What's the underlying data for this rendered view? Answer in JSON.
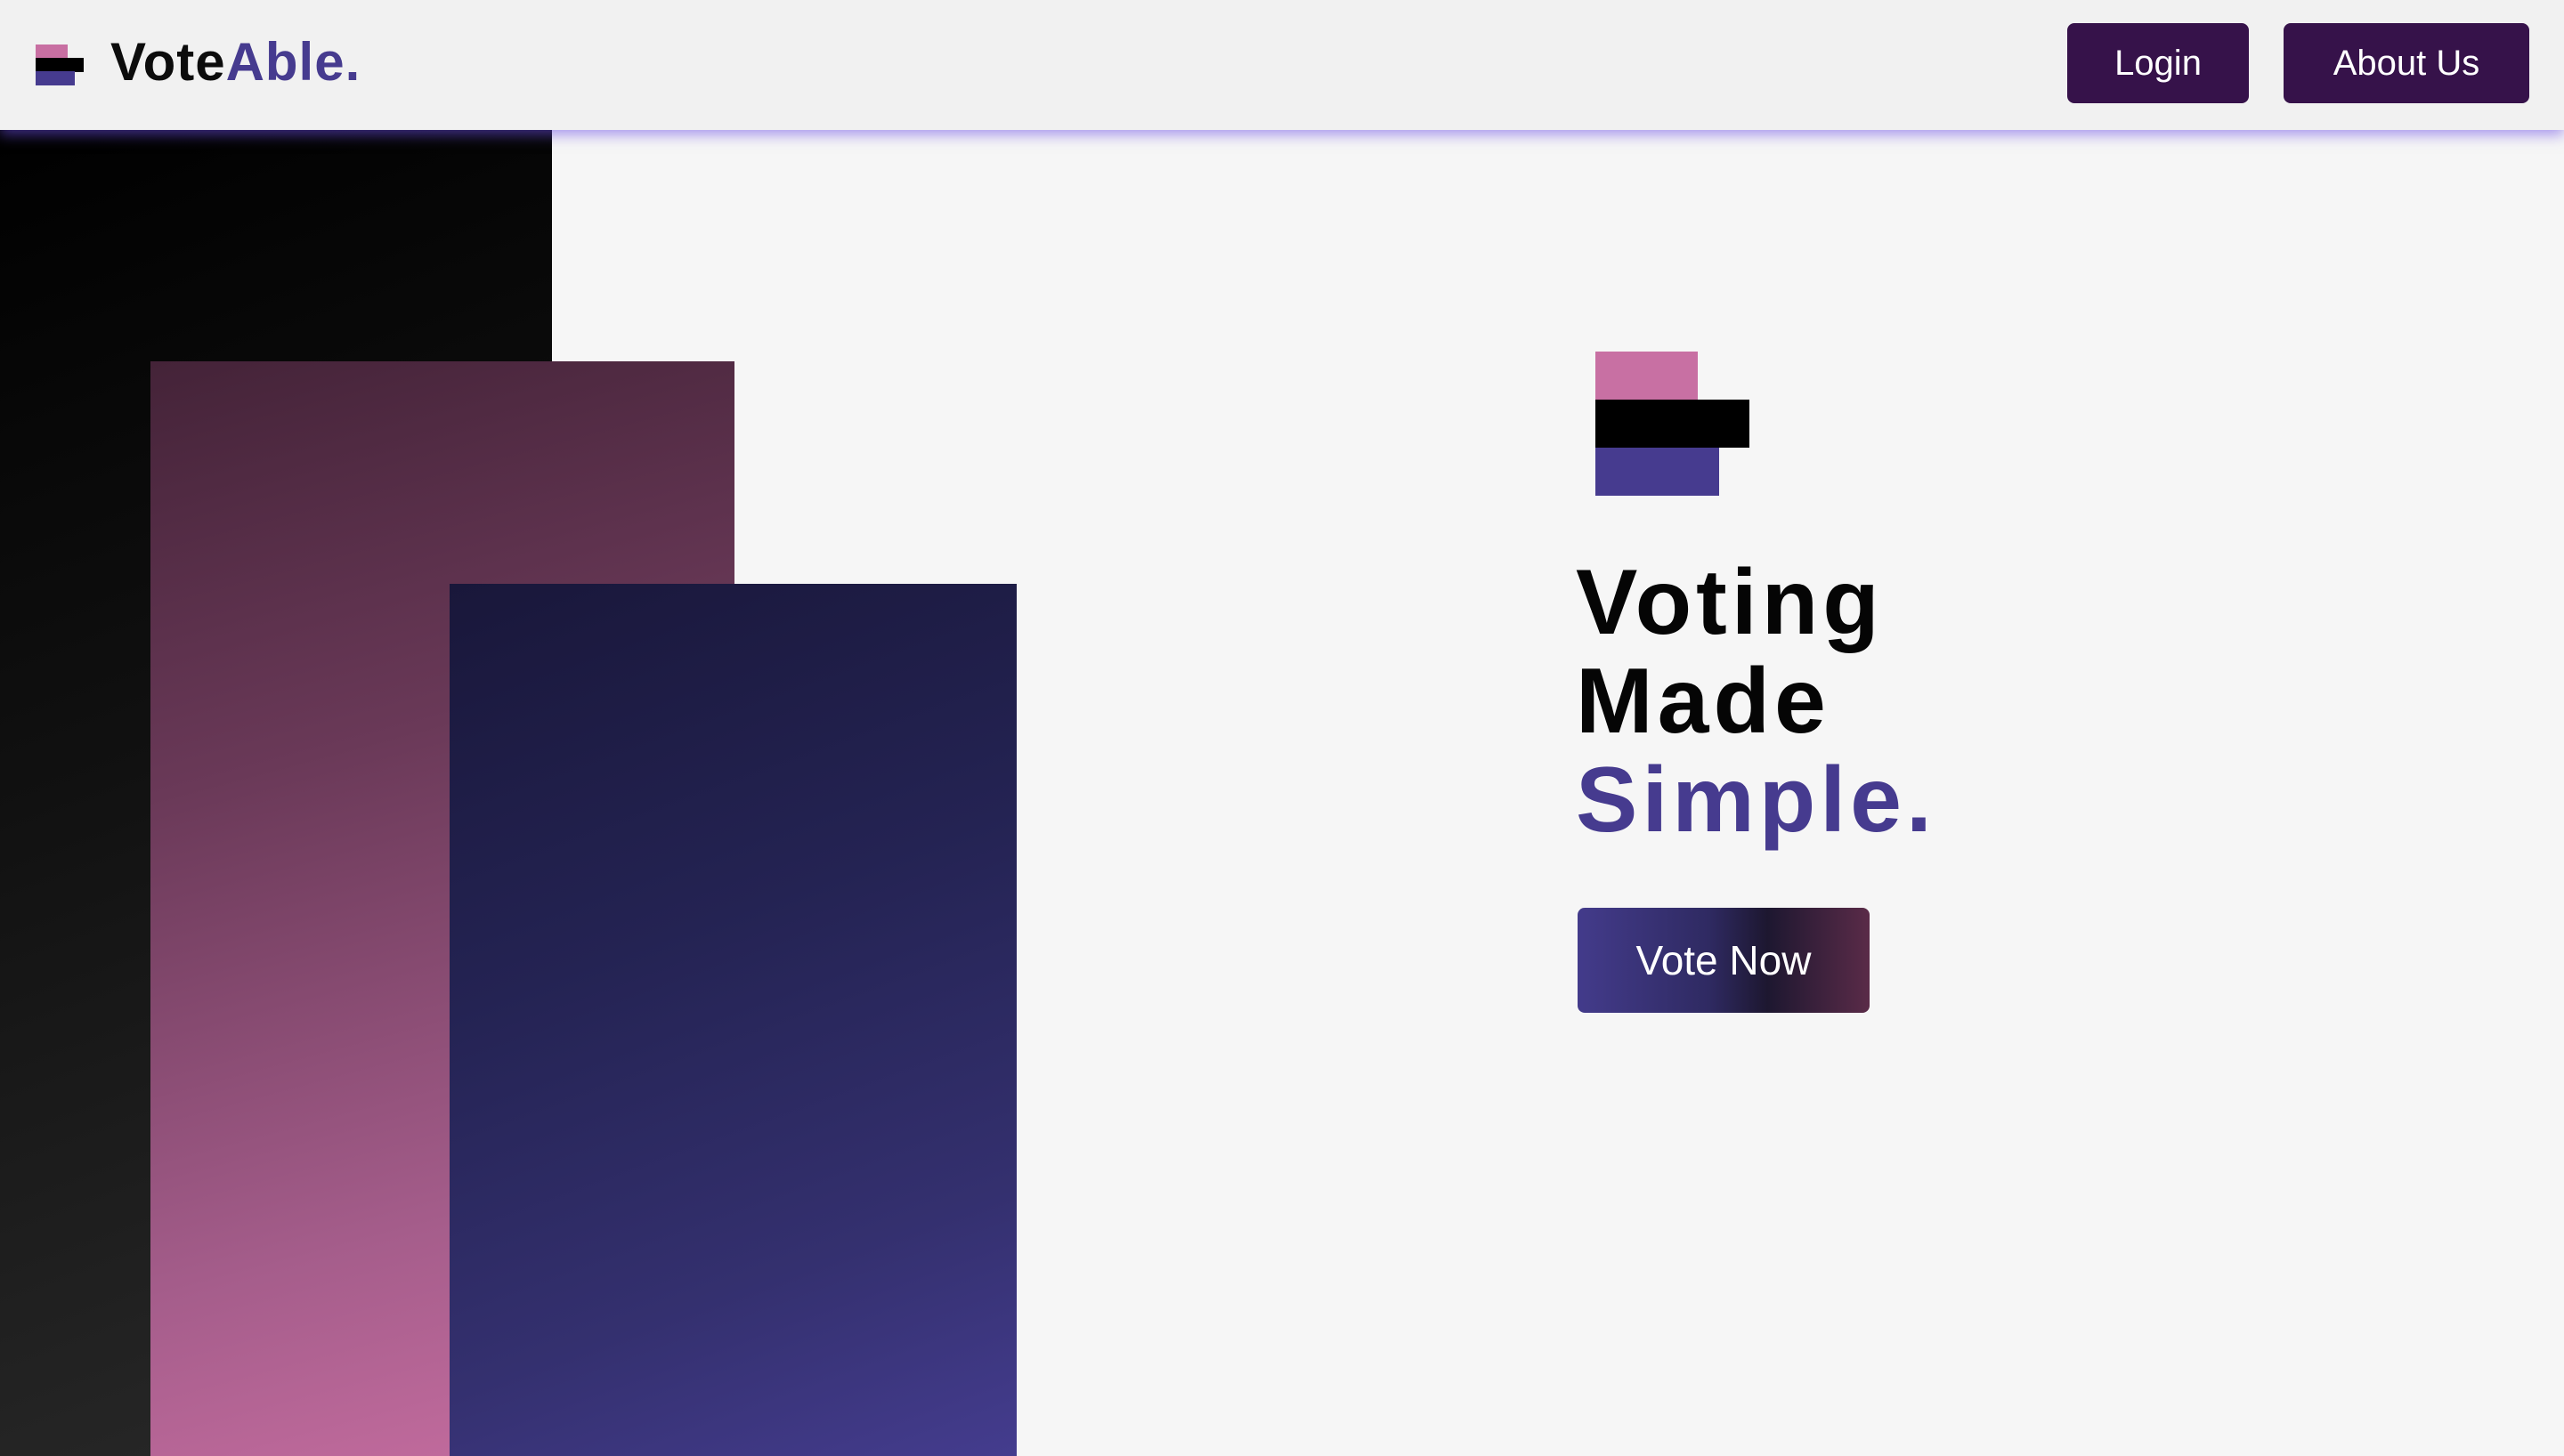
{
  "header": {
    "brand": {
      "name_part1": "Vote",
      "name_part2": "Able",
      "name_dot": ".",
      "icon": "stacked-bars-logo-icon"
    },
    "nav": {
      "login_label": "Login",
      "about_label": "About Us"
    }
  },
  "hero": {
    "logo_icon": "stacked-bars-logo-icon",
    "title_line1": "Voting",
    "title_line2": "Made",
    "title_line3": "Simple.",
    "cta_label": "Vote Now"
  },
  "colors": {
    "brand_purple": "#463b8f",
    "brand_pink": "#c870a3",
    "nav_button": "#36124a",
    "black": "#000000",
    "background": "#f6f6f6"
  }
}
